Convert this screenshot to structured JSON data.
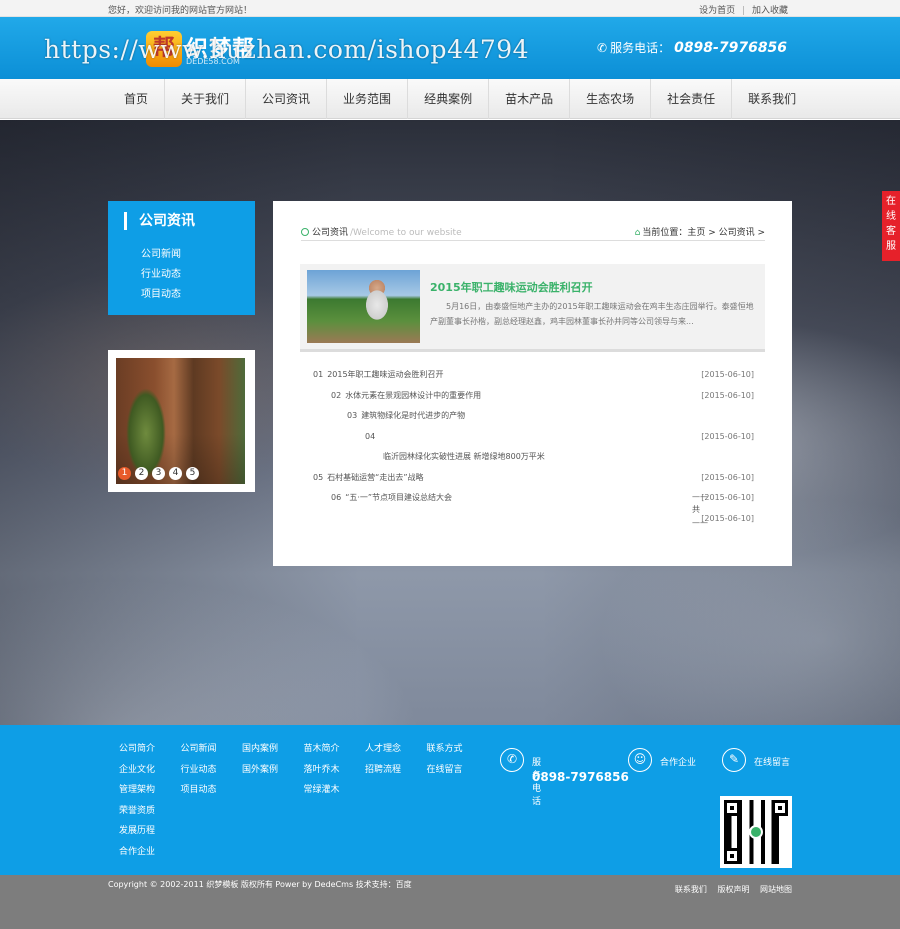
{
  "topbar": {
    "welcome": "您好，欢迎访问我的网站官方网站！",
    "set_home": "设为首页",
    "separator": "|",
    "add_fav": "加入收藏"
  },
  "header": {
    "logo_char": "帮",
    "logo_text": "织梦帮",
    "logo_sub": "DEDE58.COM",
    "watermark": "https://www.huzhan.com/ishop44794",
    "phone_label": "服务电话：",
    "phone_number": "0898-7976856"
  },
  "nav": [
    "首页",
    "关于我们",
    "公司资讯",
    "业务范围",
    "经典案例",
    "苗木产品",
    "生态农场",
    "社会责任",
    "联系我们"
  ],
  "online_service": [
    "在",
    "线",
    "客",
    "服"
  ],
  "sidebar": {
    "title": "公司资讯",
    "items": [
      "公司新闻",
      "行业动态",
      "项目动态"
    ]
  },
  "slider": {
    "pages": [
      "1",
      "2",
      "3",
      "4",
      "5"
    ],
    "active_page": 1
  },
  "main": {
    "section_title": "公司资讯",
    "section_sub": "/Welcome to our website",
    "location_label": "当前位置：",
    "crumbs": "主页 > 公司资讯 >",
    "featured": {
      "title": "2015年职工趣味运动会胜利召开",
      "desc": "5月16日，由泰盛恒地产主办的2015年职工趣味运动会在鸡丰生态庄园举行。泰盛恒地产副董事长孙楷，副总经理赵鑫，鸡丰园林董事长孙井同等公司领导与来..."
    },
    "news": [
      {
        "num": "01",
        "title": "2015年职工趣味运动会胜利召开",
        "date": "[2015-06-10]",
        "indent": 0
      },
      {
        "num": "02",
        "title": "水体元素在景观园林设计中的重要作用",
        "date": "[2015-06-10]",
        "indent": 18
      },
      {
        "num": "03",
        "title": "建筑物绿化是时代进步的产物",
        "date": "",
        "indent": 34
      },
      {
        "num": "04",
        "title": "",
        "date": "[2015-06-10]",
        "indent": 52
      },
      {
        "num": "",
        "title": "临沂园林绿化实破性进展 新增绿地800万平米",
        "date": "",
        "indent": 66
      },
      {
        "num": "05",
        "title": "石村基础运营“走出去”战略",
        "date": "[2015-06-10]",
        "indent": 0
      },
      {
        "num": "06",
        "title": "“五·一”节点项目建设总结大会",
        "date": "[2015-06-10]",
        "indent": 18
      },
      {
        "num": "",
        "title": "",
        "date": "[2015-06-10]",
        "indent": 0
      }
    ],
    "pager": "共"
  },
  "footer": {
    "columns": [
      [
        "公司简介",
        "企业文化",
        "管理架构",
        "荣誉资质",
        "发展历程",
        "合作企业"
      ],
      [
        "公司新闻",
        "行业动态",
        "项目动态"
      ],
      [
        "国内案例",
        "国外案例"
      ],
      [
        "苗木简介",
        "落叶乔木",
        "常绿灌木"
      ],
      [
        "人才理念",
        "招聘流程"
      ],
      [
        "联系方式",
        "在线留言"
      ]
    ],
    "service_label": "服务电话",
    "service_number": "0898-7976856",
    "partner_label": "合作企业",
    "message_label": "在线留言"
  },
  "copyright": {
    "text": "Copyright © 2002-2011 织梦模板 版权所有 Power by DedeCms 技术支持：百度",
    "links": [
      "联系我们",
      "版权声明",
      "网站地图"
    ]
  },
  "colors": {
    "primary": "#0e9ee6",
    "accent_green": "#3ab26a",
    "online_red": "#e6212a",
    "footer_gray": "#7d7d7d"
  }
}
